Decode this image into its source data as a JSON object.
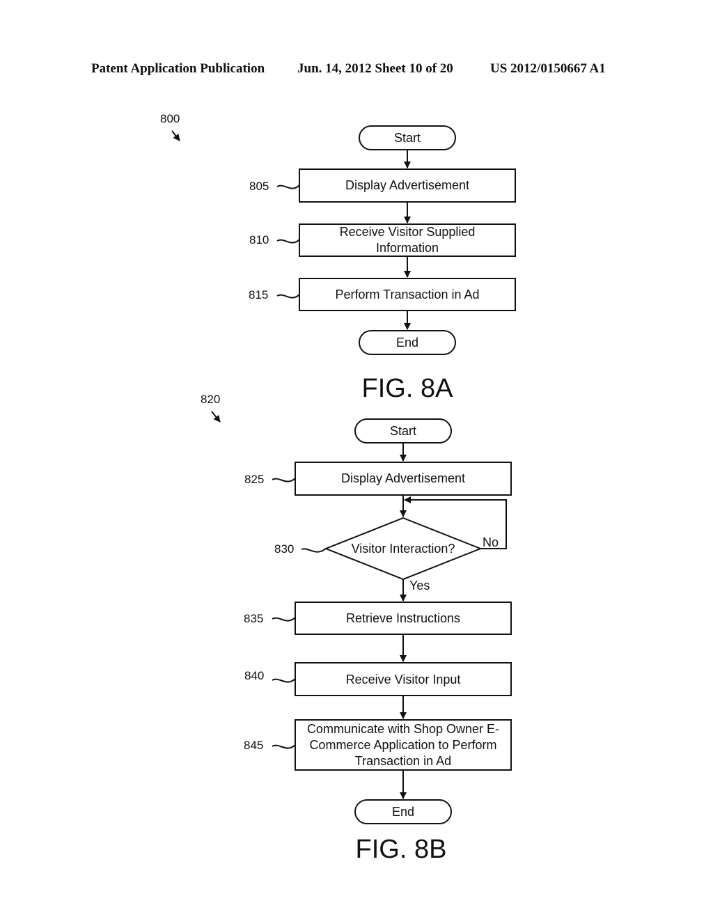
{
  "header": {
    "publication": "Patent Application Publication",
    "date_sheet": "Jun. 14, 2012  Sheet 10 of 20",
    "number": "US 2012/0150667 A1"
  },
  "fig8a": {
    "ref": "800",
    "caption": "FIG. 8A",
    "start": "Start",
    "end": "End",
    "steps": [
      {
        "ref": "805",
        "lines": [
          "Display Advertisement"
        ]
      },
      {
        "ref": "810",
        "lines": [
          "Receive Visitor Supplied",
          "Information"
        ]
      },
      {
        "ref": "815",
        "lines": [
          "Perform Transaction in Ad"
        ]
      }
    ]
  },
  "fig8b": {
    "ref": "820",
    "caption": "FIG. 8B",
    "start": "Start",
    "end": "End",
    "display": {
      "ref": "825",
      "lines": [
        "Display Advertisement"
      ]
    },
    "decision": {
      "ref": "830",
      "label": "Visitor Interaction?",
      "no": "No",
      "yes": "Yes"
    },
    "steps": [
      {
        "ref": "835",
        "lines": [
          "Retrieve Instructions"
        ]
      },
      {
        "ref": "840",
        "lines": [
          "Receive Visitor Input"
        ]
      },
      {
        "ref": "845",
        "lines": [
          "Communicate with Shop Owner E-",
          "Commerce Application to Perform",
          "Transaction in Ad"
        ]
      }
    ]
  }
}
